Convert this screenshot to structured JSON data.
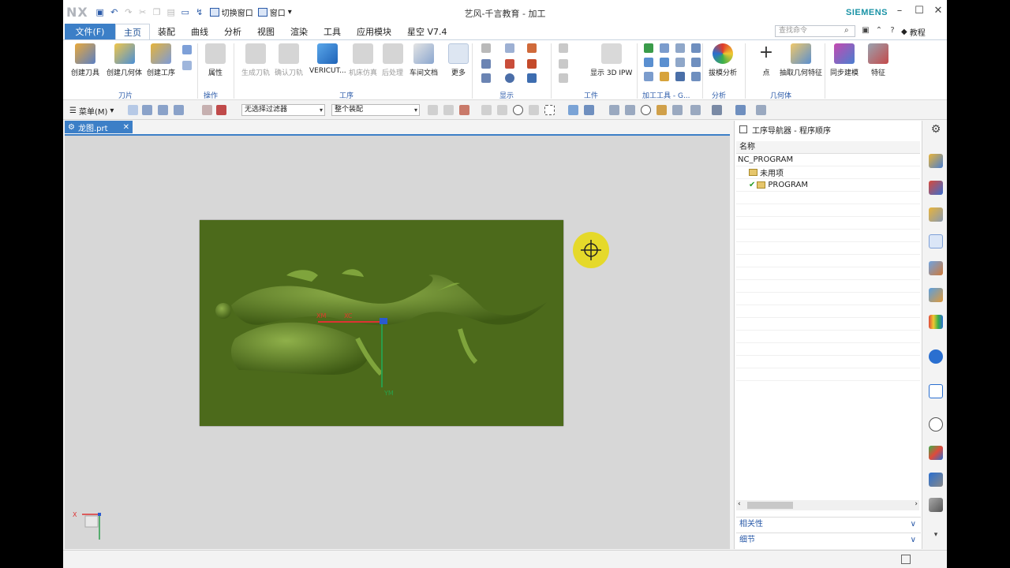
{
  "window": {
    "logo": "NX",
    "title": "艺风-千言教育 - 加工",
    "brand": "SIEMENS",
    "switch_window": "切换窗口",
    "window_menu": "窗口"
  },
  "menu": {
    "file": "文件(F)",
    "tabs": [
      "主页",
      "装配",
      "曲线",
      "分析",
      "视图",
      "渲染",
      "工具",
      "应用模块",
      "星空 V7.4"
    ],
    "search_placeholder": "查找命令",
    "tutorial": "教程"
  },
  "ribbon": {
    "create_tool": "创建刀具",
    "create_geometry": "创建几何体",
    "create_operation": "创建工序",
    "properties": "属性",
    "gen_toolpath": "生成刀轨",
    "confirm_toolpath": "确认刀轨",
    "vericut": "VERICUT...",
    "machine_sim": "机床仿真",
    "postprocess": "后处理",
    "shop_doc": "车间文档",
    "more": "更多",
    "show_3d_ipw": "显示 3D IPW",
    "draft_analysis": "拔模分析",
    "point": "点",
    "extract_geometry": "抽取几何特征",
    "sync_modeling": "同步建模",
    "feature": "特征",
    "groups": {
      "tool": "刀片",
      "ops": "操作",
      "operation": "工序",
      "display": "显示",
      "workpiece": "工件",
      "mfg_tools": "加工工具 - G...",
      "analysis": "分析",
      "geometry": "几何体"
    }
  },
  "toolbar": {
    "menu": "菜单(M)",
    "filter": "无选择过滤器",
    "scope": "整个装配"
  },
  "document": {
    "tab_name": "龙图.prt",
    "axis_xm": "XM",
    "axis_xc": "XC",
    "axis_ym": "YM",
    "triad_x": "X"
  },
  "navigator": {
    "title": "工序导航器 - 程序顺序",
    "column": "名称",
    "root": "NC_PROGRAM",
    "items": [
      "未用项",
      "PROGRAM"
    ],
    "relevance": "相关性",
    "details": "细节"
  }
}
